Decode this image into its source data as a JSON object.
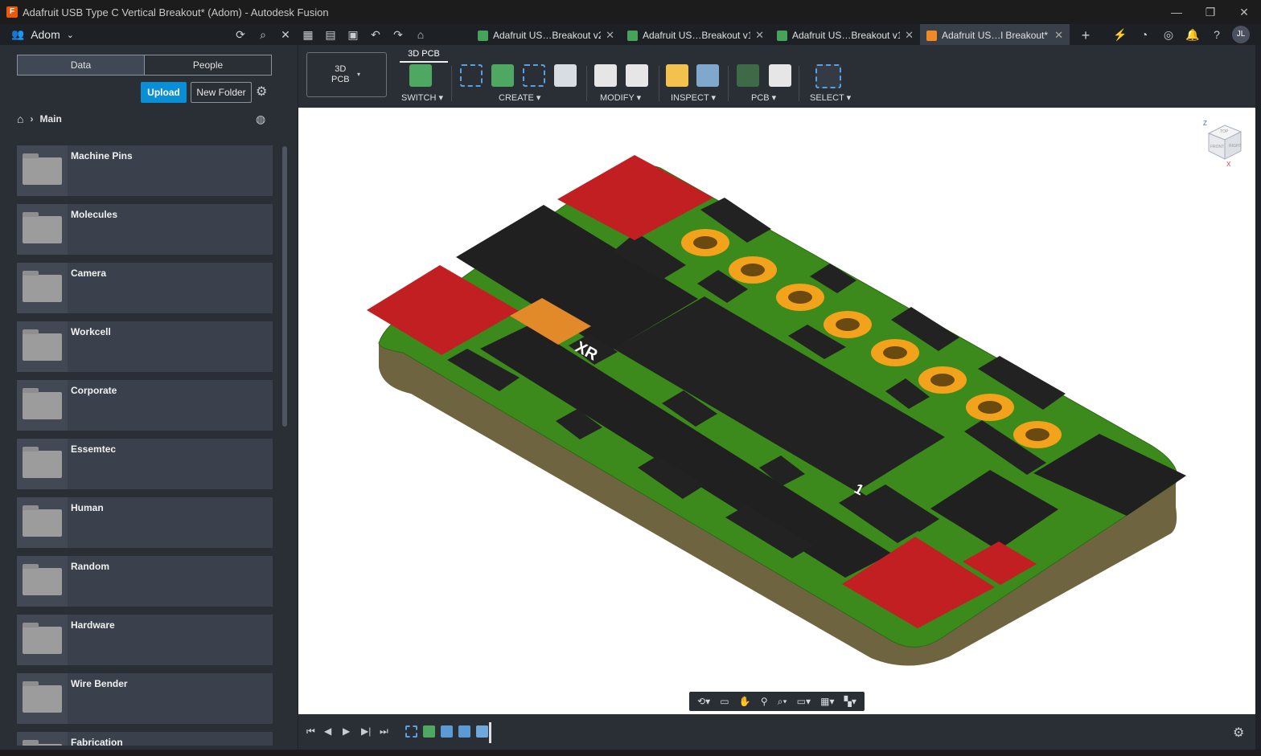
{
  "window": {
    "title": "Adafruit USB Type C Vertical Breakout* (Adom) - Autodesk Fusion",
    "controls": [
      "—",
      "❐",
      "✕"
    ]
  },
  "topbar": {
    "team_name": "Adom",
    "icons": [
      "refresh-icon",
      "search-icon",
      "close-icon",
      "apps-icon",
      "file-icon",
      "save-icon",
      "undo-icon",
      "redo-icon",
      "home-icon"
    ]
  },
  "tabs": [
    {
      "label": "Adafruit US…Breakout v2",
      "icon_color": "#46a35a",
      "active": false
    },
    {
      "label": "Adafruit US…Breakout v1",
      "icon_color": "#46a35a",
      "active": false
    },
    {
      "label": "Adafruit US…Breakout v1",
      "icon_color": "#46a35a",
      "active": false
    },
    {
      "label": "Adafruit US…l Breakout*",
      "icon_color": "#f08a24",
      "active": true
    }
  ],
  "user": {
    "initials": "JL"
  },
  "sidebar": {
    "segment": {
      "data": "Data",
      "people": "People"
    },
    "upload_label": "Upload",
    "new_folder_label": "New Folder",
    "breadcrumb": {
      "current": "Main"
    },
    "folders": [
      "Machine Pins",
      "Molecules",
      "Camera",
      "Workcell",
      "Corporate",
      "Essemtec",
      "Human",
      "Random",
      "Hardware",
      "Wire Bender",
      "Fabrication"
    ]
  },
  "ribbon": {
    "workspace": {
      "line1": "3D",
      "line2": "PCB"
    },
    "active_tab": "3D PCB",
    "groups": {
      "switch": "SWITCH ▾",
      "create": "CREATE ▾",
      "modify": "MODIFY ▾",
      "inspect": "INSPECT ▾",
      "pcb": "PCB ▾",
      "select": "SELECT ▾"
    }
  },
  "viewcube": {
    "top": "TOP",
    "front": "FRONT",
    "right": "RIGHT",
    "axis_z": "Z",
    "axis_x": "X"
  },
  "board_silkscreen": {
    "label_a": "XR",
    "label_b": "1"
  },
  "colors": {
    "accent": "#0a8ed6",
    "board_green": "#3c8a1c",
    "pad_red": "#c21f23",
    "pad_gold": "#f2a31b",
    "component_black": "#202020",
    "board_substrate": "#6e6540"
  }
}
